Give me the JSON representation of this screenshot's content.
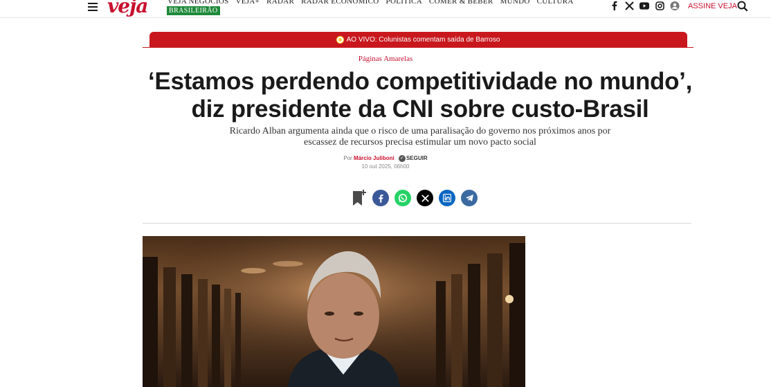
{
  "header": {
    "logo": "veja",
    "nav_items": [
      "VEJA NEGÓCIOS",
      "VEJA+",
      "RADAR",
      "RADAR ECONÔMICO",
      "POLÍTICA",
      "COMER & BEBER",
      "MUNDO",
      "CULTURA"
    ],
    "badge": "BRASILEIRÃO",
    "subscribe": "ASSINE VEJA",
    "icons": [
      "menu-icon",
      "facebook-icon",
      "x-icon",
      "youtube-icon",
      "instagram-icon",
      "user-icon",
      "search-icon"
    ]
  },
  "live_banner": {
    "text": "AO VIVO: Colunistas comentam saída de Barroso",
    "color": "#c8181e"
  },
  "article": {
    "section": "Páginas Amarelas",
    "headline_line1": "‘Estamos perdendo competitividade no mundo’,",
    "headline_line2": "diz presidente da CNI sobre custo-Brasil",
    "dek_line1": "Ricardo Alban argumenta ainda que o risco de uma paralisação do governo nos próximos anos por",
    "dek_line2": "escassez de recursos precisa estimular um novo pacto social",
    "by_prefix": "Por",
    "author": "Márcio Juliboni",
    "follow": "SEGUIR",
    "date": "10 out 2025, 06h00"
  },
  "share": {
    "buttons": [
      {
        "name": "bookmark-icon"
      },
      {
        "name": "facebook-share",
        "color": "#3b5998"
      },
      {
        "name": "whatsapp-share",
        "color": "#25d366"
      },
      {
        "name": "x-share",
        "color": "#000000"
      },
      {
        "name": "linkedin-share",
        "color": "#0a66c2"
      },
      {
        "name": "telegram-share",
        "color": "#3b6aa0"
      }
    ]
  },
  "colors": {
    "accent": "#c8102e",
    "badge_green": "#1e8a3a"
  }
}
